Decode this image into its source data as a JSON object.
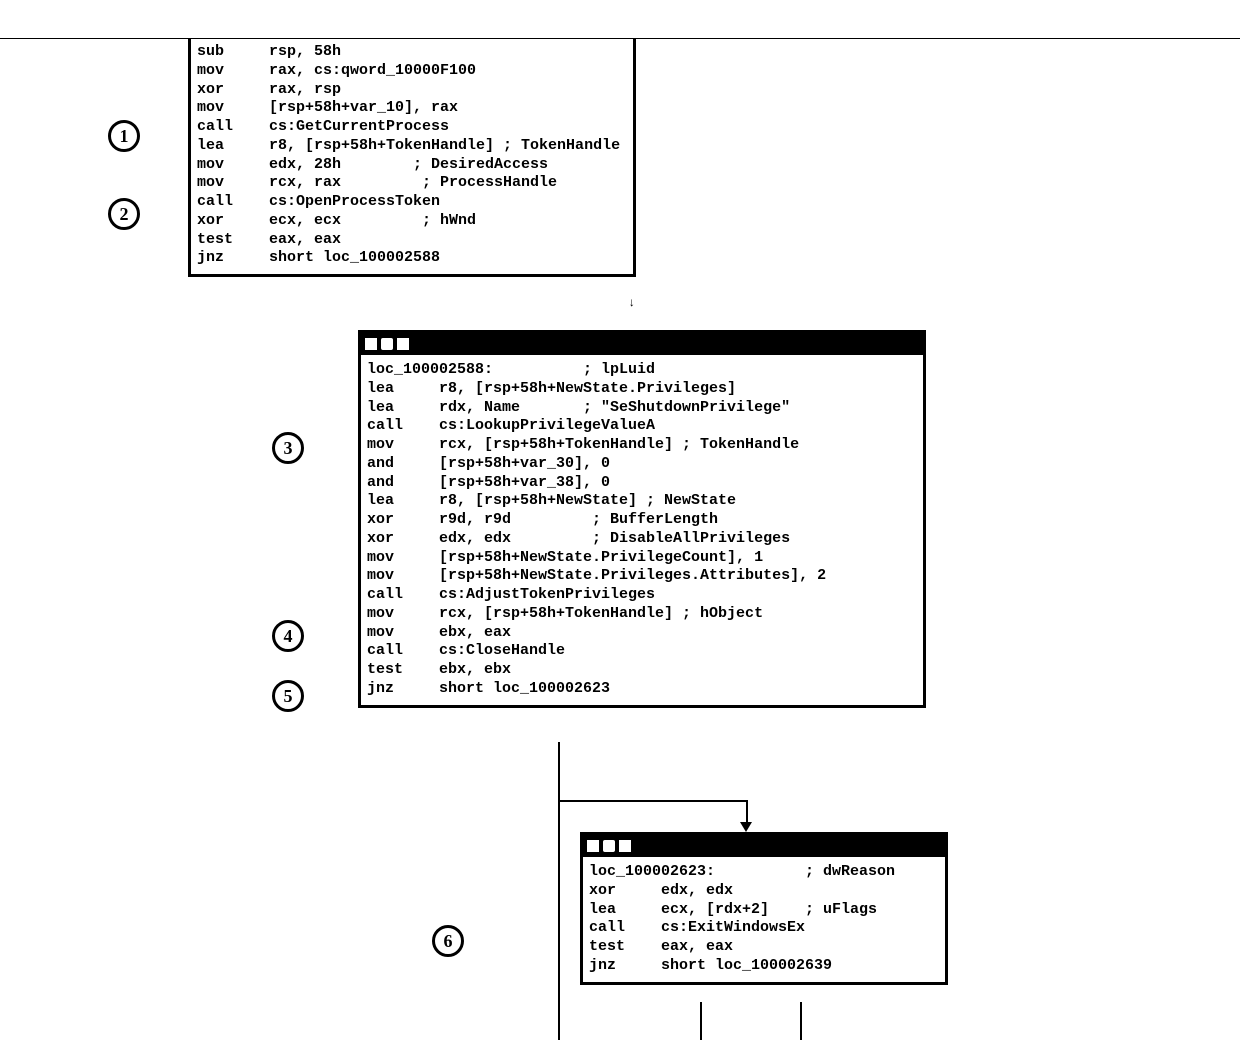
{
  "badges": [
    "1",
    "2",
    "3",
    "4",
    "5",
    "6"
  ],
  "arrow_mark": "↓",
  "block1": {
    "lines": [
      "sub     rsp, 58h",
      "mov     rax, cs:qword_10000F100",
      "xor     rax, rsp",
      "mov     [rsp+58h+var_10], rax",
      "call    cs:GetCurrentProcess",
      "lea     r8, [rsp+58h+TokenHandle] ; TokenHandle",
      "mov     edx, 28h        ; DesiredAccess",
      "mov     rcx, rax         ; ProcessHandle",
      "call    cs:OpenProcessToken",
      "xor     ecx, ecx         ; hWnd",
      "test    eax, eax",
      "jnz     short loc_100002588"
    ]
  },
  "block2": {
    "lines": [
      "loc_100002588:          ; lpLuid",
      "lea     r8, [rsp+58h+NewState.Privileges]",
      "lea     rdx, Name       ; \"SeShutdownPrivilege\"",
      "call    cs:LookupPrivilegeValueA",
      "mov     rcx, [rsp+58h+TokenHandle] ; TokenHandle",
      "and     [rsp+58h+var_30], 0",
      "and     [rsp+58h+var_38], 0",
      "lea     r8, [rsp+58h+NewState] ; NewState",
      "xor     r9d, r9d         ; BufferLength",
      "xor     edx, edx         ; DisableAllPrivileges",
      "mov     [rsp+58h+NewState.PrivilegeCount], 1",
      "mov     [rsp+58h+NewState.Privileges.Attributes], 2",
      "call    cs:AdjustTokenPrivileges",
      "mov     rcx, [rsp+58h+TokenHandle] ; hObject",
      "mov     ebx, eax",
      "call    cs:CloseHandle",
      "test    ebx, ebx",
      "jnz     short loc_100002623"
    ]
  },
  "block3": {
    "lines": [
      "loc_100002623:          ; dwReason",
      "xor     edx, edx",
      "lea     ecx, [rdx+2]    ; uFlags",
      "call    cs:ExitWindowsEx",
      "test    eax, eax",
      "jnz     short loc_100002639"
    ]
  }
}
